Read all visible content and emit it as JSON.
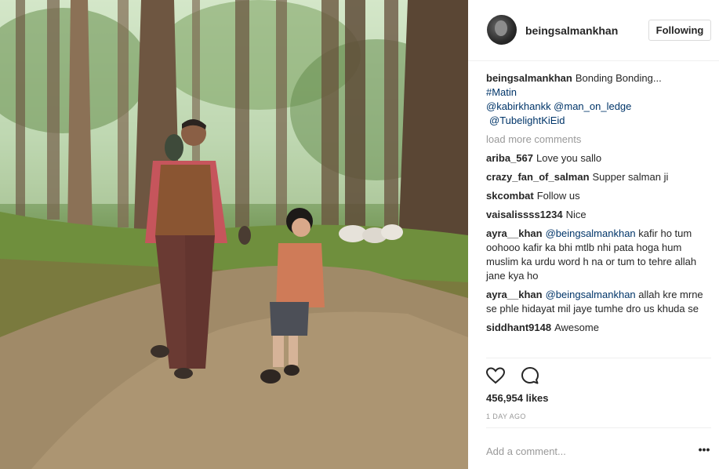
{
  "header": {
    "username": "beingsalmankhan",
    "follow_label": "Following"
  },
  "photo": {
    "alt": "Man and child walking on a forest path"
  },
  "caption": {
    "username": "beingsalmankhan",
    "text": "Bonding Bonding...",
    "hashtag": "#Matin",
    "mentions_line1": "@kabirkhankk @man_on_ledge",
    "mentions_line2": "@TubelightKiEid"
  },
  "load_more": "load more comments",
  "comments": [
    {
      "user": "ariba_567",
      "mention": "",
      "text": "Love you sallo"
    },
    {
      "user": "crazy_fan_of_salman",
      "mention": "",
      "text": "Supper salman ji"
    },
    {
      "user": "skcombat",
      "mention": "",
      "text": "Follow us"
    },
    {
      "user": "vaisalissss1234",
      "mention": "",
      "text": "Nice"
    },
    {
      "user": "ayra__khan",
      "mention": "@beingsalmankhan",
      "text": "kafir ho tum oohooo kafir ka bhi mtlb nhi pata hoga hum muslim ka urdu word h na or tum to tehre allah jane kya ho"
    },
    {
      "user": "ayra__khan",
      "mention": "@beingsalmankhan",
      "text": "allah kre mrne se phle hidayat mil jaye tumhe dro us khuda se"
    },
    {
      "user": "siddhant9148",
      "mention": "",
      "text": "Awesome"
    }
  ],
  "actions": {
    "like_icon": "heart-icon",
    "comment_icon": "comment-icon"
  },
  "likes_text": "456,954 likes",
  "time_text": "1 DAY AGO",
  "add_comment": {
    "placeholder": "Add a comment..."
  },
  "more_label": "•••"
}
